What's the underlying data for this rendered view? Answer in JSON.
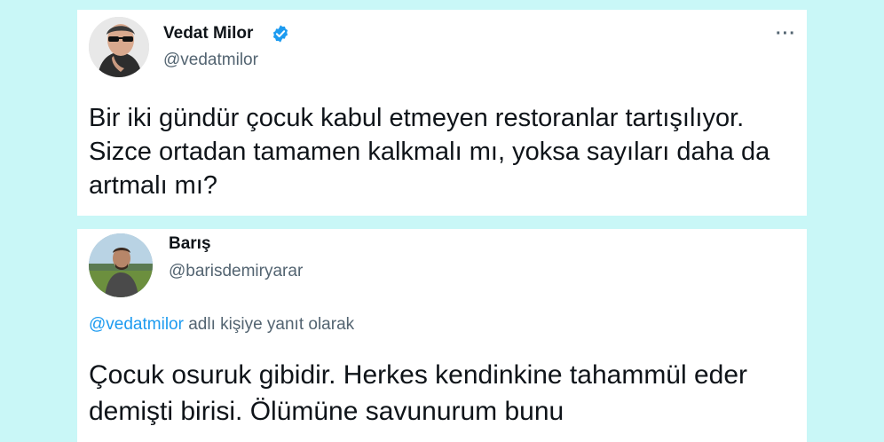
{
  "tweet1": {
    "name": "Vedat Milor",
    "handle": "@vedatmilor",
    "text": "Bir iki gündür çocuk kabul etmeyen restoranlar tartışılıyor. Sizce ortadan tamamen kalkmalı mı, yoksa sayıları daha da artmalı mı?",
    "more": "···"
  },
  "tweet2": {
    "name": "Barış",
    "handle": "@barisdemiryarar",
    "reply_mention": "@vedatmilor",
    "reply_suffix": " adlı kişiye yanıt olarak",
    "text": "Çocuk osuruk gibidir. Herkes kendinkine tahammül eder demişti birisi. Ölümüne savunurum bunu"
  },
  "colors": {
    "background": "#c9f7f7",
    "card": "#ffffff",
    "text": "#0f1419",
    "secondary": "#536471",
    "accent": "#1d9bf0"
  }
}
